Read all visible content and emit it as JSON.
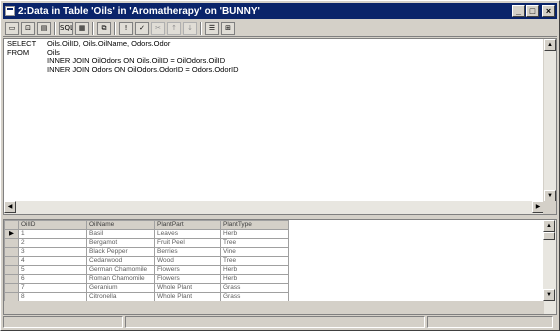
{
  "window": {
    "title": "2:Data in Table 'Oils' in 'Aromatherapy' on 'BUNNY'",
    "controls": {
      "minimize": "_",
      "maximize": "□",
      "close": "×"
    }
  },
  "toolbar": {
    "buttons": [
      {
        "name": "sql-pane-toggle",
        "label": "▭",
        "disabled": false
      },
      {
        "name": "diagram-pane-toggle",
        "label": "⊡",
        "disabled": false
      },
      {
        "name": "grid-pane-toggle",
        "label": "▤",
        "disabled": false
      },
      {
        "name": "sql-button",
        "label": "SQL",
        "disabled": false
      },
      {
        "name": "results-button",
        "label": "▦",
        "disabled": false
      },
      {
        "name": "change-query-type",
        "label": "⧉",
        "disabled": false
      },
      {
        "name": "run-button",
        "label": "!",
        "disabled": false
      },
      {
        "name": "verify-sql",
        "label": "✓",
        "disabled": false
      },
      {
        "name": "remove-filter",
        "label": "✂",
        "disabled": true
      },
      {
        "name": "sort-asc",
        "label": "↑",
        "disabled": true
      },
      {
        "name": "sort-desc",
        "label": "↓",
        "disabled": true
      },
      {
        "name": "properties-button",
        "label": "☰",
        "disabled": false
      },
      {
        "name": "add-table-button",
        "label": "⊞",
        "disabled": false
      }
    ]
  },
  "sql": {
    "lines": [
      {
        "kw": "SELECT",
        "text": "Oils.OilID, Oils.OilName, Odors.Odor"
      },
      {
        "kw": "FROM",
        "text": "Oils"
      },
      {
        "kw": "",
        "text": "INNER JOIN OilOdors ON Oils.OilID = OilOdors.OilID"
      },
      {
        "kw": "",
        "text": "INNER JOIN Odors ON OilOdors.OdorID = Odors.OdorID"
      }
    ]
  },
  "grid": {
    "columns": [
      "OilID",
      "OilName",
      "PlantPart",
      "PlantType"
    ],
    "rows": [
      [
        "1",
        "Basil",
        "Leaves",
        "Herb"
      ],
      [
        "2",
        "Bergamot",
        "Fruit Peel",
        "Tree"
      ],
      [
        "3",
        "Black Pepper",
        "Berries",
        "Vine"
      ],
      [
        "4",
        "Cedarwood",
        "Wood",
        "Tree"
      ],
      [
        "5",
        "German Chamomile",
        "Flowers",
        "Herb"
      ],
      [
        "6",
        "Roman Chamomile",
        "Flowers",
        "Herb"
      ],
      [
        "7",
        "Geranium",
        "Whole Plant",
        "Grass"
      ],
      [
        "8",
        "Citronella",
        "Whole Plant",
        "Grass"
      ]
    ]
  },
  "colors": {
    "titlebar": "#0a246a",
    "chrome": "#d4d0c8"
  }
}
